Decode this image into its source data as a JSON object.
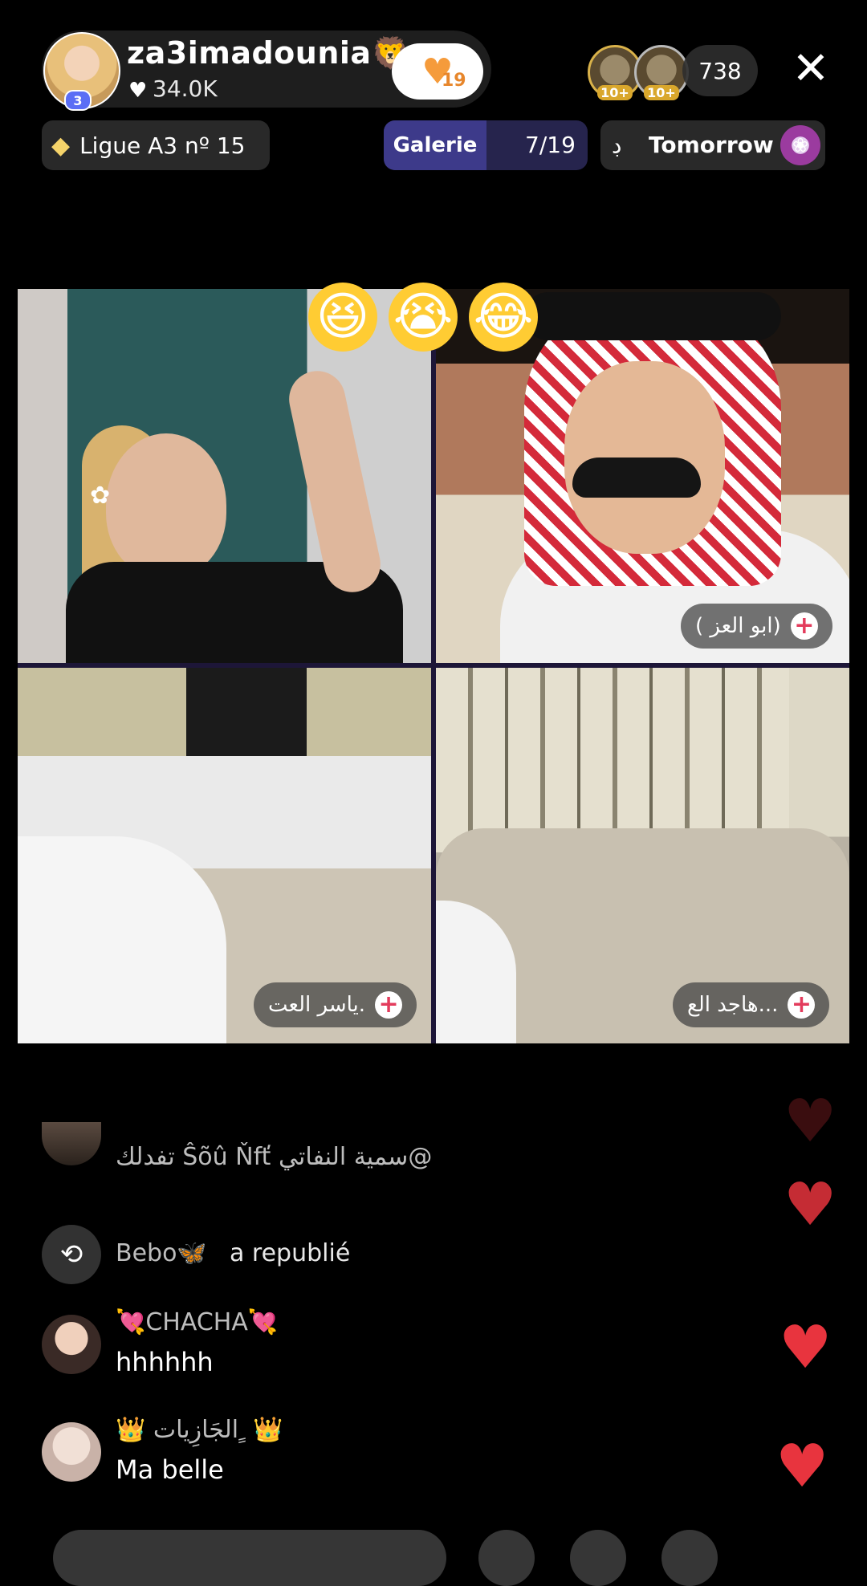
{
  "host": {
    "name": "za3imadounia🦁",
    "likes": "34.0K",
    "level": "3",
    "follow_count": "19"
  },
  "viewers": {
    "badge1": "10+",
    "badge2": "10+",
    "count": "738"
  },
  "pills": {
    "league": "Ligue A3 nº 15",
    "gallery_label": "Galerie",
    "gallery_count": "7/19",
    "event_prefix": "ڊ",
    "event_label": "Tomorrow"
  },
  "reactions": [
    "😆",
    "😭",
    "😂"
  ],
  "guests": [
    {
      "name": "( ابو العز)"
    },
    {
      "name": "ياسر العت."
    },
    {
      "name": "هاجد الع..."
    }
  ],
  "comments": [
    {
      "text": "تفدلك Ŝõû Ňfť سمية النفاتي@"
    },
    {
      "name": "Bebo🦋",
      "action": "a republié"
    },
    {
      "name": "💘CHACHA💘",
      "message": "hhhhhh"
    },
    {
      "name": "👑 الجَازِيات ٍ 👑",
      "message": "Ma belle"
    }
  ],
  "icons": {
    "close": "close-icon",
    "heart": "heart-icon",
    "repost": "repost-icon",
    "diamond": "diamond-icon",
    "plus": "plus-icon"
  },
  "colors": {
    "accent_heart": "#e8343e",
    "follow_heart": "#f59b3b",
    "gallery_bg": "#3d3a8a"
  }
}
